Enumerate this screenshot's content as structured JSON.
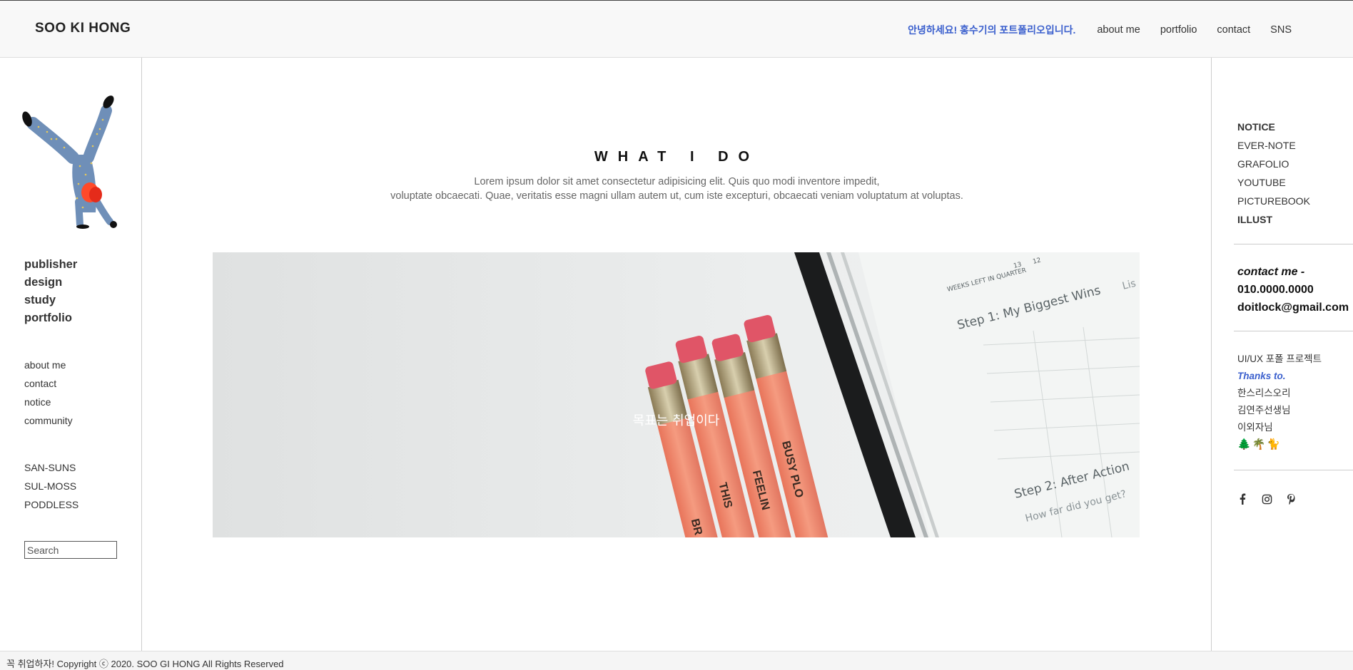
{
  "header": {
    "logo": "SOO KI HONG",
    "greeting": "안녕하세요! 홍수기의 포트폴리오입니다.",
    "nav": [
      "about me",
      "portfolio",
      "contact",
      "SNS"
    ]
  },
  "left": {
    "bold_menu": [
      "publisher",
      "design",
      "study",
      "portfolio"
    ],
    "sub_menu": [
      "about me",
      "contact",
      "notice",
      "community"
    ],
    "brands": [
      "SAN-SUNS",
      "SUL-MOSS",
      "PODDLESS"
    ],
    "search_placeholder": "Search"
  },
  "main": {
    "title": "WHAT I DO",
    "desc_line1": "Lorem ipsum dolor sit amet consectetur adipisicing elit. Quis quo modi inventore impedit,",
    "desc_line2": "voluptate obcaecati. Quae, veritatis esse magni ullam autem ut, cum iste excepturi, obcaecati veniam voluptatum at voluptas.",
    "hero_text": "목표는 취업이다",
    "hero_image": {
      "notebook_text": [
        "WEEKS LEFT IN QUARTER",
        "13",
        "12",
        "Step 1: My Biggest Wins",
        "Lis",
        "Step 2: After Action",
        "How far did you get?"
      ],
      "pencil_text": [
        "BR",
        "THIS",
        "FEELIN",
        "BUSY PLO"
      ]
    }
  },
  "right": {
    "notice_menu": [
      {
        "label": "NOTICE",
        "bold": true
      },
      {
        "label": "EVER-NOTE",
        "bold": false
      },
      {
        "label": "GRAFOLIO",
        "bold": false
      },
      {
        "label": "YOUTUBE",
        "bold": false
      },
      {
        "label": "PICTUREBOOK",
        "bold": false
      },
      {
        "label": "ILLUST",
        "bold": true
      }
    ],
    "contact_label": "contact me -",
    "phone": "010.0000.0000",
    "email": "doitlock@gmail.com",
    "project": "UI/UX 포폴 프로젝트",
    "thanks_label": "Thanks to.",
    "thanks_names": [
      "한스리스오리",
      "김연주선생님",
      "이외자님"
    ],
    "emojis": "🌲🌴🐈",
    "social_icons": [
      "facebook-icon",
      "instagram-icon",
      "pinterest-icon"
    ]
  },
  "footer": {
    "text": "꼭 취업하자! Copyright ⓒ 2020. SOO GI HONG All Rights Reserved"
  },
  "colors": {
    "accent": "#3a5fcd",
    "header_bg": "#f8f8f8",
    "pencil": "#f28b6e",
    "eraser": "#e35a68"
  }
}
